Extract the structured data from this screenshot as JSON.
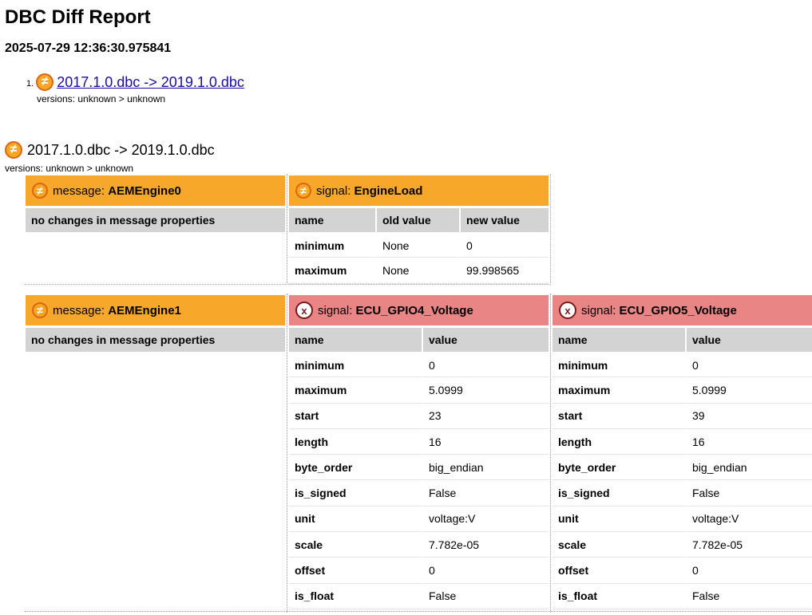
{
  "report": {
    "title": "DBC Diff Report",
    "timestamp": "2025-07-29 12:36:30.975841"
  },
  "toc": {
    "items": [
      {
        "number": "1.",
        "label": "2017.1.0.dbc -> 2019.1.0.dbc",
        "versions": "versions: unknown > unknown"
      }
    ]
  },
  "icons": {
    "changed": "≠",
    "removed": "x"
  },
  "colors": {
    "changed_header": "#f7a82a",
    "removed_header": "#e98585",
    "row_header": "#d3d3d3",
    "link": "#1a0dab"
  },
  "section": {
    "title": "2017.1.0.dbc -> 2019.1.0.dbc",
    "versions": "versions: unknown > unknown",
    "message_prefix": "message:",
    "signal_prefix": "signal:",
    "no_changes_text": "no changes in message properties",
    "messages": [
      {
        "name": "AEMEngine0",
        "signals": [
          {
            "name": "EngineLoad",
            "status": "changed",
            "columns": [
              "name",
              "old value",
              "new value"
            ],
            "rows": [
              [
                "minimum",
                "None",
                "0"
              ],
              [
                "maximum",
                "None",
                "99.998565"
              ]
            ]
          }
        ]
      },
      {
        "name": "AEMEngine1",
        "signals": [
          {
            "name": "ECU_GPIO4_Voltage",
            "status": "removed",
            "columns": [
              "name",
              "value"
            ],
            "rows": [
              [
                "minimum",
                "0"
              ],
              [
                "maximum",
                "5.0999"
              ],
              [
                "start",
                "23"
              ],
              [
                "length",
                "16"
              ],
              [
                "byte_order",
                "big_endian"
              ],
              [
                "is_signed",
                "False"
              ],
              [
                "unit",
                "voltage:V"
              ],
              [
                "scale",
                "7.782e-05"
              ],
              [
                "offset",
                "0"
              ],
              [
                "is_float",
                "False"
              ]
            ]
          },
          {
            "name": "ECU_GPIO5_Voltage",
            "status": "removed",
            "columns": [
              "name",
              "value"
            ],
            "rows": [
              [
                "minimum",
                "0"
              ],
              [
                "maximum",
                "5.0999"
              ],
              [
                "start",
                "39"
              ],
              [
                "length",
                "16"
              ],
              [
                "byte_order",
                "big_endian"
              ],
              [
                "is_signed",
                "False"
              ],
              [
                "unit",
                "voltage:V"
              ],
              [
                "scale",
                "7.782e-05"
              ],
              [
                "offset",
                "0"
              ],
              [
                "is_float",
                "False"
              ]
            ]
          }
        ]
      }
    ]
  }
}
